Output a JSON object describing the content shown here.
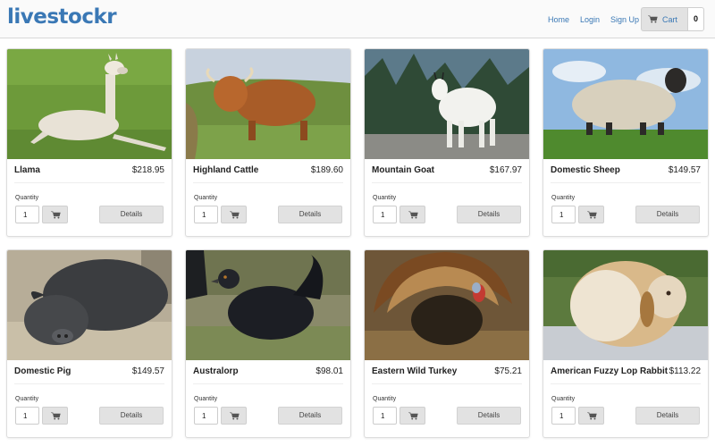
{
  "brand": {
    "name": "livestockr",
    "color": "#3a78b5"
  },
  "nav": {
    "home": "Home",
    "login": "Login",
    "signup": "Sign Up",
    "cart_label": "Cart",
    "cart_icon": "shopping-cart-icon",
    "cart_count": "0"
  },
  "product_common": {
    "quantity_label": "Quantity",
    "quantity_value": "1",
    "details_label": "Details",
    "add_to_cart_icon": "shopping-cart-icon"
  },
  "products": [
    {
      "name": "Llama",
      "price": "$218.95"
    },
    {
      "name": "Highland Cattle",
      "price": "$189.60"
    },
    {
      "name": "Mountain Goat",
      "price": "$167.97"
    },
    {
      "name": "Domestic Sheep",
      "price": "$149.57"
    },
    {
      "name": "Domestic Pig",
      "price": "$149.57"
    },
    {
      "name": "Australorp",
      "price": "$98.01"
    },
    {
      "name": "Eastern Wild Turkey",
      "price": "$75.21"
    },
    {
      "name": "American Fuzzy Lop Rabbit",
      "price": "$113.22"
    }
  ]
}
